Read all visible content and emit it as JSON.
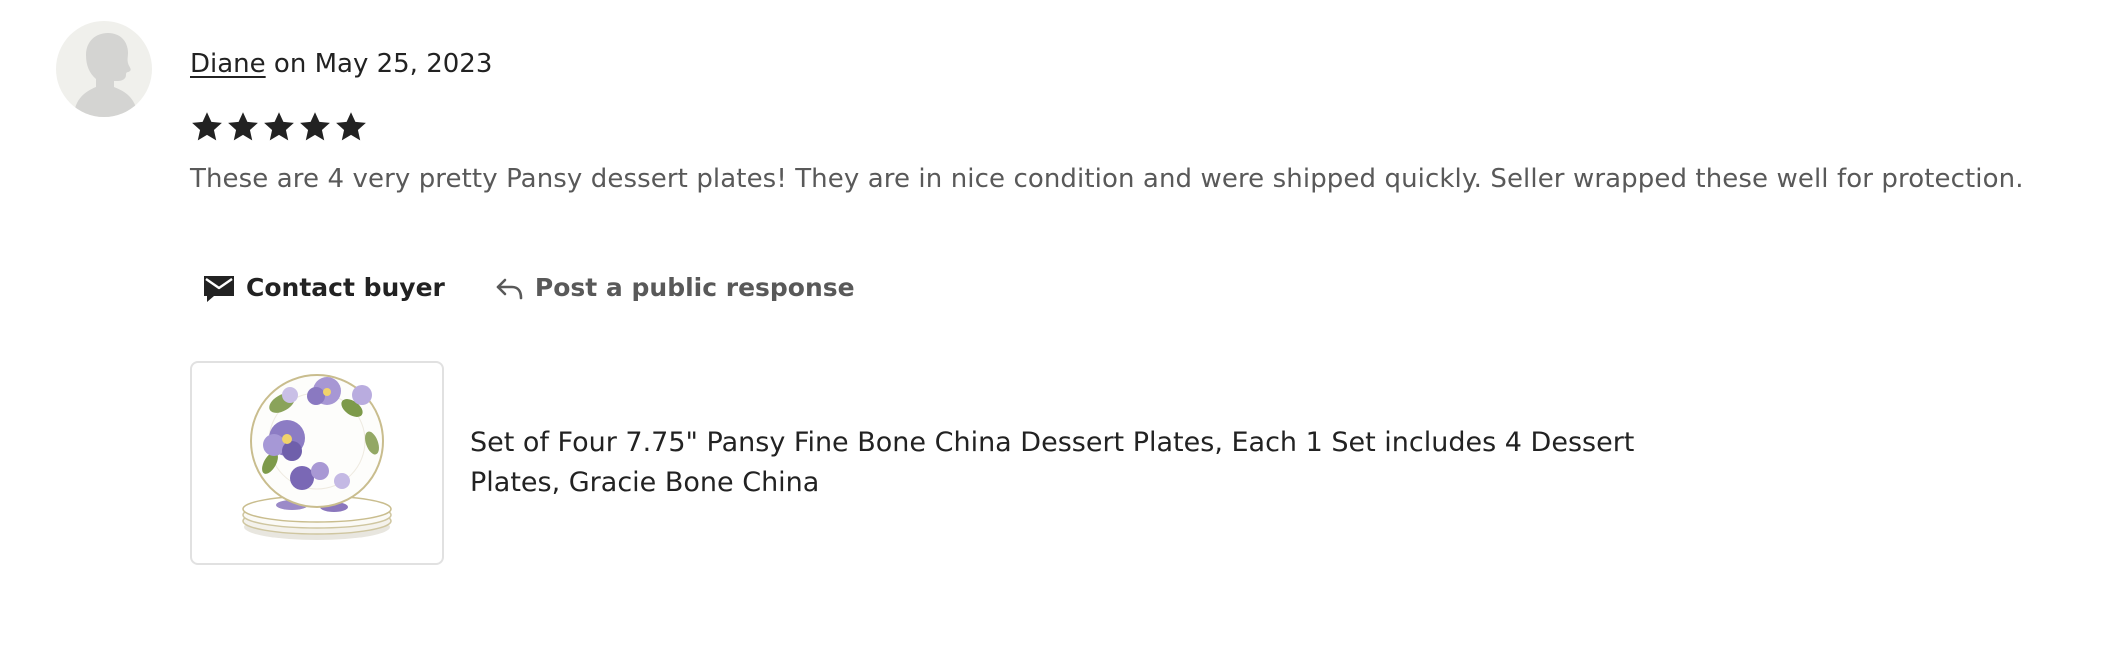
{
  "review": {
    "author": "Diane",
    "date_prefix": " on ",
    "date": "May 25, 2023",
    "rating": 5,
    "text": "These are 4 very pretty Pansy dessert plates! They are in nice condition and were shipped quickly. Seller wrapped these well for protection."
  },
  "actions": {
    "contact_label": "Contact buyer",
    "respond_label": "Post a public response"
  },
  "listing": {
    "title": "Set of Four 7.75\" Pansy Fine Bone China Dessert Plates, Each 1 Set includes 4 Dessert Plates, Gracie Bone China"
  },
  "icons": {
    "avatar": "person-silhouette-icon",
    "star": "star-icon",
    "contact": "envelope-icon",
    "respond": "reply-arrow-icon"
  },
  "colors": {
    "text_primary": "#222222",
    "text_secondary": "#595959",
    "avatar_bg": "#f0f0ec",
    "thumb_border": "#e1e1e1"
  }
}
